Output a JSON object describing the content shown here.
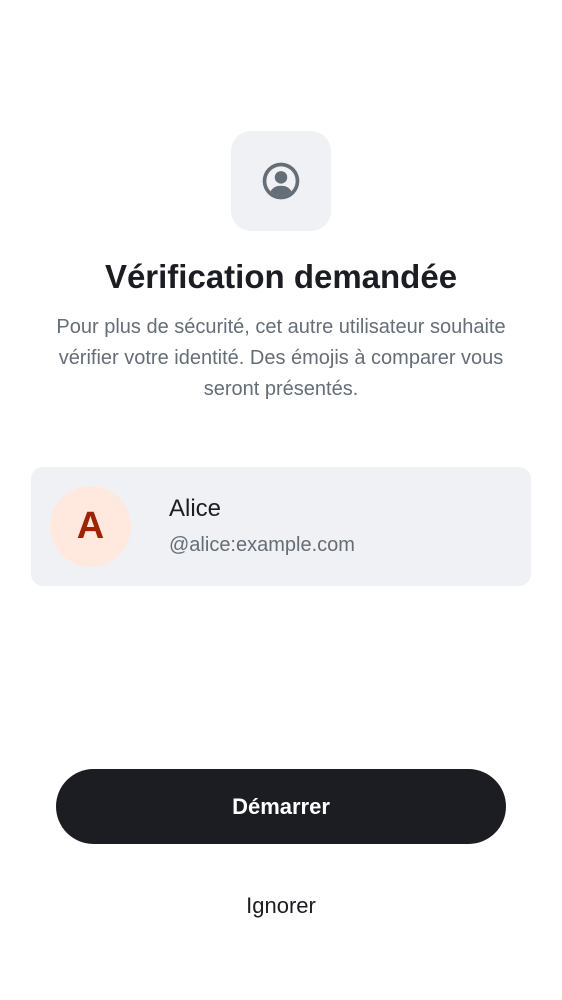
{
  "header": {
    "icon": "user-profile-icon",
    "title": "Vérification demandée",
    "description": "Pour plus de sécurité, cet autre utilisateur souhaite vérifier votre identité. Des émojis à comparer vous seront présentés."
  },
  "user": {
    "avatar_initial": "A",
    "name": "Alice",
    "id": "@alice:example.com"
  },
  "actions": {
    "primary_label": "Démarrer",
    "secondary_label": "Ignorer"
  },
  "colors": {
    "background": "#ffffff",
    "card_background": "#eff1f5",
    "primary_text": "#1b1d22",
    "secondary_text": "#656d77",
    "avatar_background": "#ffe9df",
    "avatar_text": "#9d2303",
    "button_background": "#1b1d22",
    "button_text": "#ffffff"
  }
}
